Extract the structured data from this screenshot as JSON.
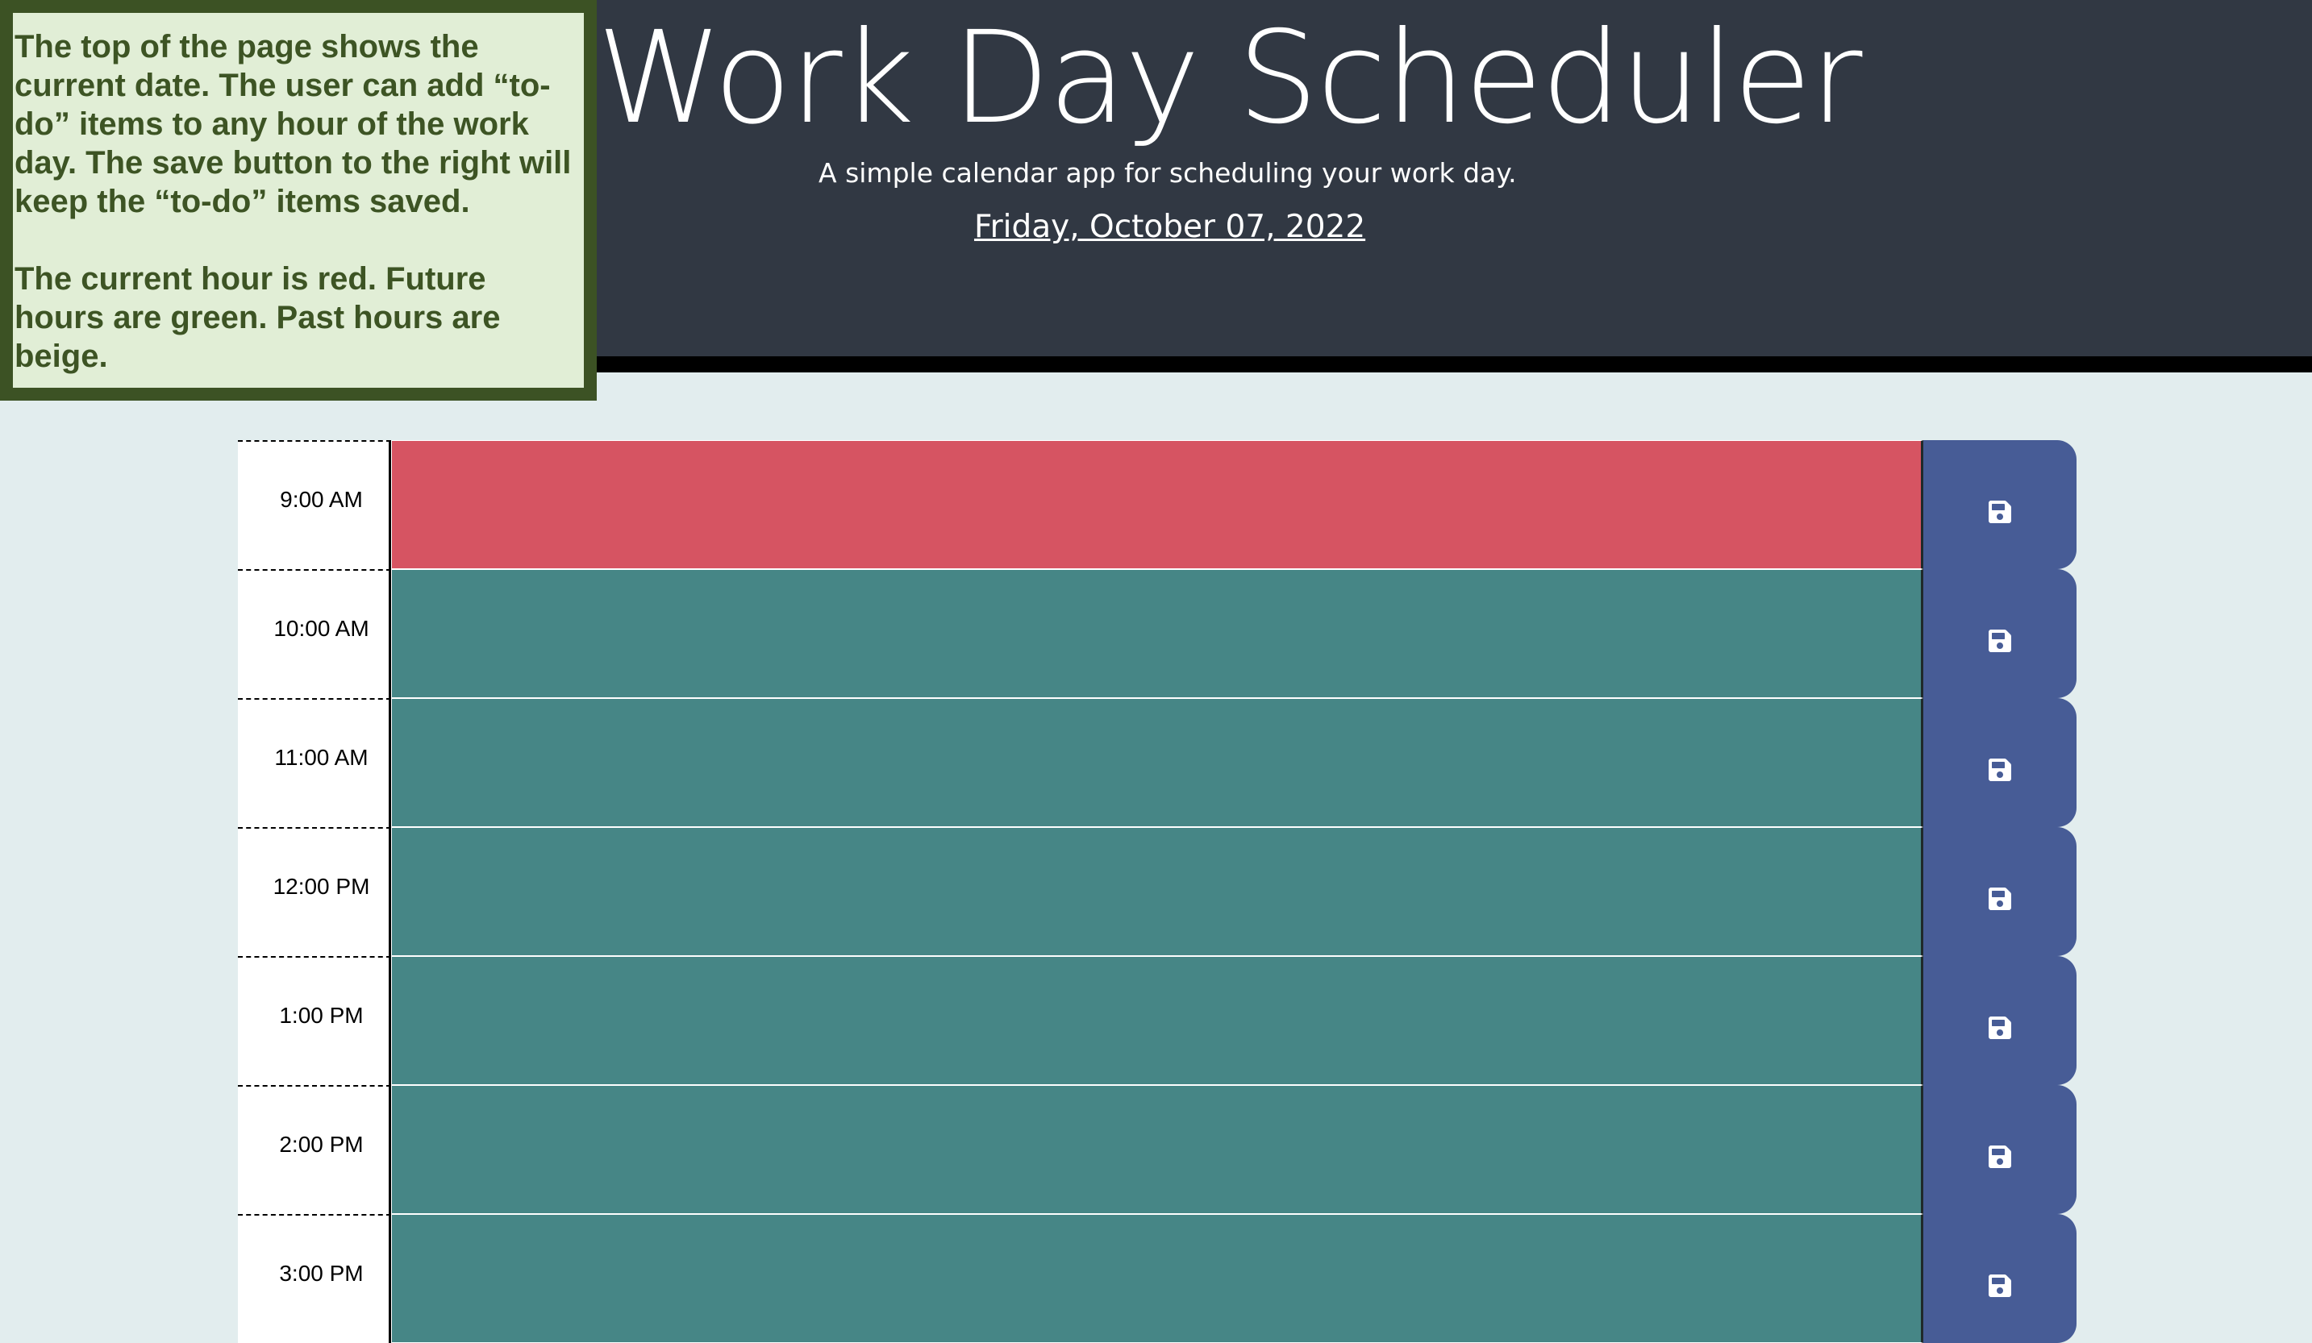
{
  "header": {
    "title": "Work Day Scheduler",
    "subtitle": "A simple calendar app for scheduling your work day.",
    "current_date": "Friday, October 07, 2022"
  },
  "note": {
    "paragraph_1": "The top of the page shows the current date. The user can add “to-do” items to any hour of the work day. The save button to the right will keep the “to-do” items saved.",
    "paragraph_2": "The current hour is red. Future hours are green. Past hours are beige."
  },
  "colors": {
    "header_bg": "#313843",
    "page_bg": "#e2edee",
    "present": "#d65462",
    "future": "#468686",
    "past": "#d3d3d3",
    "save_button": "#475c96",
    "note_bg": "#e1eed6",
    "note_border": "#3c5224"
  },
  "schedule": {
    "save_icon": "floppy-disk-icon",
    "blocks": [
      {
        "hour_label": "9:00 AM",
        "text": "",
        "status": "present"
      },
      {
        "hour_label": "10:00 AM",
        "text": "",
        "status": "future"
      },
      {
        "hour_label": "11:00 AM",
        "text": "",
        "status": "future"
      },
      {
        "hour_label": "12:00 PM",
        "text": "",
        "status": "future"
      },
      {
        "hour_label": "1:00 PM",
        "text": "",
        "status": "future"
      },
      {
        "hour_label": "2:00 PM",
        "text": "",
        "status": "future"
      },
      {
        "hour_label": "3:00 PM",
        "text": "",
        "status": "future"
      }
    ]
  }
}
